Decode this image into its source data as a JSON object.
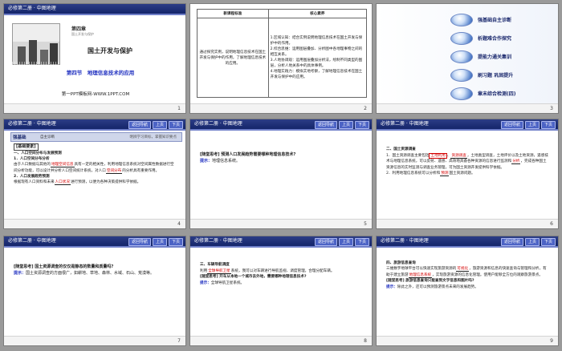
{
  "header": {
    "title": "必修第二册 · 中图地理",
    "nav_return": "返回导航",
    "nav_prev": "上页",
    "nav_next": "下页"
  },
  "slide1": {
    "chapter": "第四章",
    "chapter_sub": "国土开发与保护",
    "title": "国土开发与保护",
    "section": "第四节　地理信息技术的应用",
    "site": "第一PPT模板网-WWW.1PPT.COM",
    "num": "1"
  },
  "slide2": {
    "col1": "新课程标准",
    "col2": "核心素养",
    "standard": "通过探究实例，说明地理信息技术在国土开发与保护中的作用，了解地理信息技术的应用。",
    "core": [
      "1.区域认知：结合实例说明地理信息技术在国土开发与保护中的作用。",
      "2.综合思维：运用图层叠加、分析图中各地理事物之间的相互关系。",
      "3.人地协调观：运用图层叠加分析法，绘制不同类型的图层，分析人地关系中的具体事例。",
      "4.地理实践力：模拟实地考察，了解地理信息技术在国土开发与保护中的应用。"
    ],
    "num": "2"
  },
  "slide3": {
    "items": [
      "强基础自主诊断",
      "析题难合作探究",
      "提能力通关集训",
      "刷习题 巩固提升",
      "章末综合检测(四)"
    ],
    "num": "3"
  },
  "slide4": {
    "strip_a": "强基础",
    "strip_b": "自主诊断",
    "strip_c": "明辨学习目标，掌握知识要点",
    "tag": "[基础要素]",
    "h1": "一、人口空间分布与发展预测",
    "h1a": "1．人口空间分布分析",
    "p1a": "由于人口数据与其他的",
    "p1_blank": "地理空间信息",
    "p1b": "具有一定的相关性，利用地理信息系统对空间属性数据进行空间分析功能，可以设计并分析人口空间统计系统，对人口",
    "p1_blank2": "空间分布",
    "p1c": "的分析具有重要作用。",
    "h1b": "2．人口发展趋势预测",
    "p2a": "根据现有人口资料和未来",
    "p2_blank": "人口状况",
    "p2b": "进行预测，以便为各种决策提供科学依据。",
    "num": "4"
  },
  "slide5": {
    "q": "[随堂思考] 预测人口发展趋势需要哪种地理信息技术?",
    "a_label": "提示：",
    "a": "地理信息系统。",
    "num": "5"
  },
  "slide6": {
    "h": "二、国土资源调查",
    "p1a": "1．国土资源调查主要包括",
    "blank1": "土地利用",
    "p1b": "、",
    "blank2": "资源调查",
    "p1c": "，土地类型调查，土地评价以及土地资源，遥感技术与地理信息系统，可以反射、遥感、高效地具备各种资源的信息进行监测和",
    "blank3": "分析",
    "p1d": "，完成各种国土资源信息的实时监测与调查业务管理，可为国土资源开发提供科学依据。",
    "p2a": "2．利用地理信息系统可以分析和",
    "blank4": "预测",
    "p2b": "国土资源问题。",
    "num": "6"
  },
  "slide7": {
    "q": "[随堂思考] 国土资源调查的仅仅是静态的数量和质量吗?",
    "a_label": "提示：",
    "a": "国土资源调查的方面很广，如耕地、草地、森林、水域、石山、荒漠等。",
    "num": "7"
  },
  "slide8": {
    "h": "三、车辆导航调度",
    "p1a": "利用",
    "blank1": "全球导航卫星",
    "p1b": "系统，我可以对车辆进行导航监视、调度管理，合理分配车辆。",
    "q": "[随堂思考] 开车从本地一个城市去外地，需要哪种地理信息技术?",
    "a_label": "提示：",
    "a": "全球导航卫星系统。",
    "num": "8"
  },
  "slide9": {
    "h": "四、旅游信息查询",
    "p1a": "三维数字地球平台可以快速实现旅游资源的",
    "blank1": "可视化",
    "p1b": "，旅游资源和信息的快速查询与管理和分析，有助于建立旅游",
    "blank2": "地理信息系统",
    "p1c": "，实现旅游资源的信息化管理。使用户能够全方位的观察旅游景点。",
    "q": "[随堂思考] 旅游信息查询只能查到文字信息和图片吗?",
    "a_label": "提示：",
    "a": "除此之外，还可以预测旅游景点未来的发展趋势。",
    "num": "9"
  }
}
